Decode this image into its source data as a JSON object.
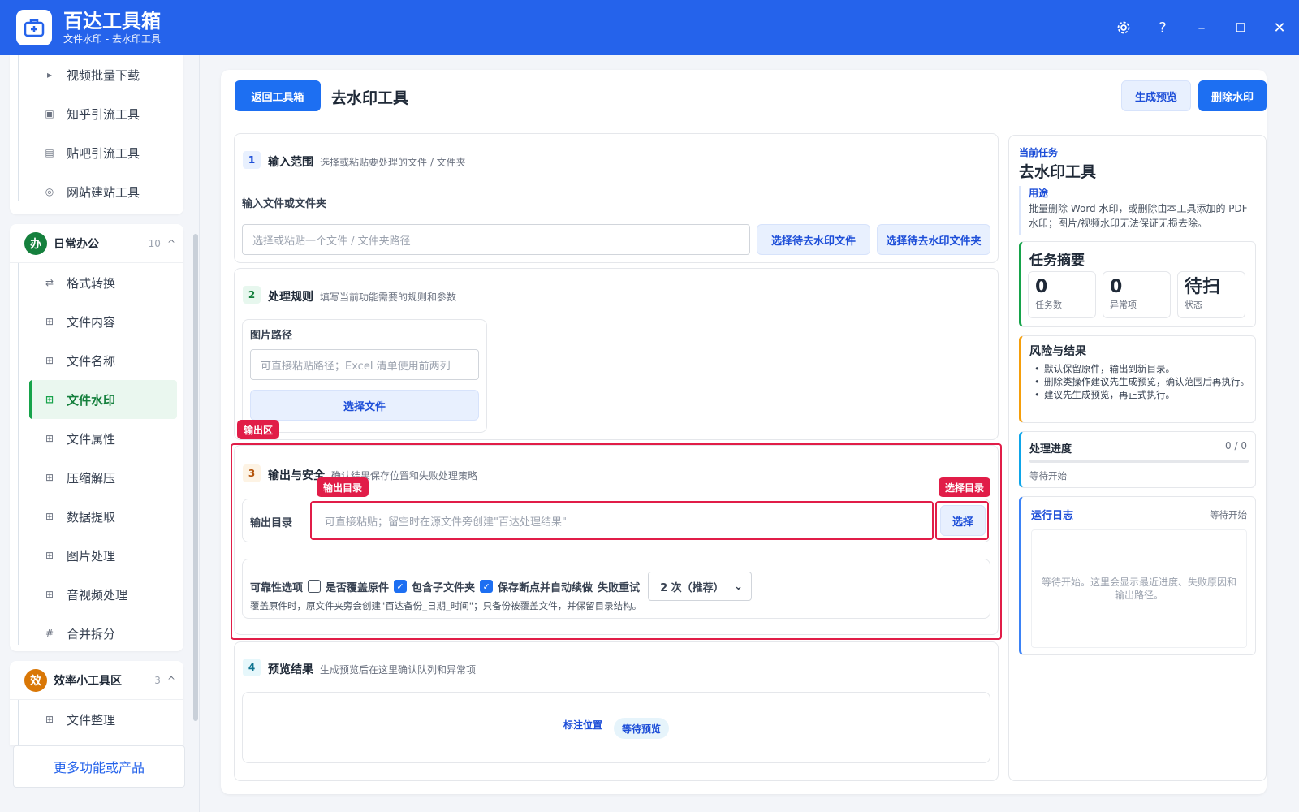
{
  "titlebar": {
    "app_name": "百达工具箱",
    "subtitle": "文件水印 - 去水印工具",
    "icons": [
      "settings-icon",
      "help-icon",
      "minimize-icon",
      "maximize-icon",
      "close-icon"
    ]
  },
  "sidebar": {
    "top_items": [
      {
        "label": "视频批量下载",
        "icon": "play-icon"
      },
      {
        "label": "知乎引流工具",
        "icon": "zhihu-icon"
      },
      {
        "label": "贴吧引流工具",
        "icon": "tieba-icon"
      },
      {
        "label": "网站建站工具",
        "icon": "globe-icon"
      }
    ],
    "group_office": {
      "badge": "办",
      "name": "日常办公",
      "count": "10",
      "chevron": "^"
    },
    "office_items": [
      {
        "label": "格式转换",
        "icon": "⇄"
      },
      {
        "label": "文件内容",
        "icon": "⊞"
      },
      {
        "label": "文件名称",
        "icon": "⊞"
      },
      {
        "label": "文件水印",
        "icon": "⊞",
        "active": true
      },
      {
        "label": "文件属性",
        "icon": "⊞"
      },
      {
        "label": "压缩解压",
        "icon": "⊞"
      },
      {
        "label": "数据提取",
        "icon": "⊞"
      },
      {
        "label": "图片处理",
        "icon": "⊞"
      },
      {
        "label": "音视频处理",
        "icon": "⊞"
      },
      {
        "label": "合并拆分",
        "icon": "#"
      }
    ],
    "group_eff": {
      "badge": "效",
      "name": "效率小工具区",
      "count": "3",
      "chevron": "^"
    },
    "eff_items": [
      {
        "label": "文件整理",
        "icon": "⊞"
      }
    ],
    "more_label": "更多功能或产品"
  },
  "toolbar": {
    "back_label": "返回工具箱",
    "title": "去水印工具",
    "preview_label": "生成预览",
    "delete_label": "删除水印"
  },
  "step1": {
    "num": "1",
    "title": "输入范围",
    "desc": "选择或粘贴要处理的文件 / 文件夹",
    "field_label": "输入文件或文件夹",
    "placeholder": "选择或粘贴一个文件 / 文件夹路径",
    "btn_file": "选择待去水印文件",
    "btn_folder": "选择待去水印文件夹"
  },
  "step2": {
    "num": "2",
    "title": "处理规则",
    "desc": "填写当前功能需要的规则和参数",
    "field_label": "图片路径",
    "placeholder": "可直接粘贴路径；Excel 清单使用前两列",
    "btn": "选择文件"
  },
  "step3": {
    "tag": "输出区",
    "num": "3",
    "title": "输出与安全",
    "desc": "确认结果保存位置和失败处理策略",
    "out_label": "输出目录",
    "out_tag": "输出目录",
    "placeholder": "可直接粘贴；留空时在源文件旁创建\"百达处理结果\"",
    "select_btn": "选择",
    "select_tag": "选择目录",
    "rel_label": "可靠性选项",
    "opt_overwrite": "是否覆盖原件",
    "opt_subfolder": "包含子文件夹",
    "opt_resume": "保存断点并自动续做",
    "retry_label": "失败重试",
    "retry_value": "2 次（推荐）",
    "note": "覆盖原件时，原文件夹旁会创建\"百达备份_日期_时间\"；只备份被覆盖文件，并保留目录结构。"
  },
  "step4": {
    "num": "4",
    "title": "预览结果",
    "desc": "生成预览后在这里确认队列和异常项",
    "marker_label": "标注位置",
    "status_badge": "等待预览"
  },
  "right": {
    "current_label": "当前任务",
    "tool_name": "去水印工具",
    "usage_label": "用途",
    "usage_text": "批量删除 Word 水印，或删除由本工具添加的 PDF 水印；图片/视频水印无法保证无损去除。",
    "summary_title": "任务摘要",
    "stats": [
      {
        "value": "0",
        "label": "任务数"
      },
      {
        "value": "0",
        "label": "异常项"
      },
      {
        "value": "待扫",
        "label": "状态"
      }
    ],
    "risk_title": "风险与结果",
    "risks": [
      "默认保留原件，输出到新目录。",
      "删除类操作建议先生成预览，确认范围后再执行。",
      "建议先生成预览，再正式执行。"
    ],
    "progress_title": "处理进度",
    "progress_count": "0 / 0",
    "progress_fraction": 0,
    "progress_status": "等待开始",
    "log_title": "运行日志",
    "log_status": "等待开始",
    "log_placeholder": "等待开始。这里会显示最近进度、失败原因和输出路径。"
  },
  "colors": {
    "primary": "#2563eb",
    "accent_green": "#16a34a",
    "alert_red": "#e11d48",
    "risk_orange": "#f59e0b"
  }
}
